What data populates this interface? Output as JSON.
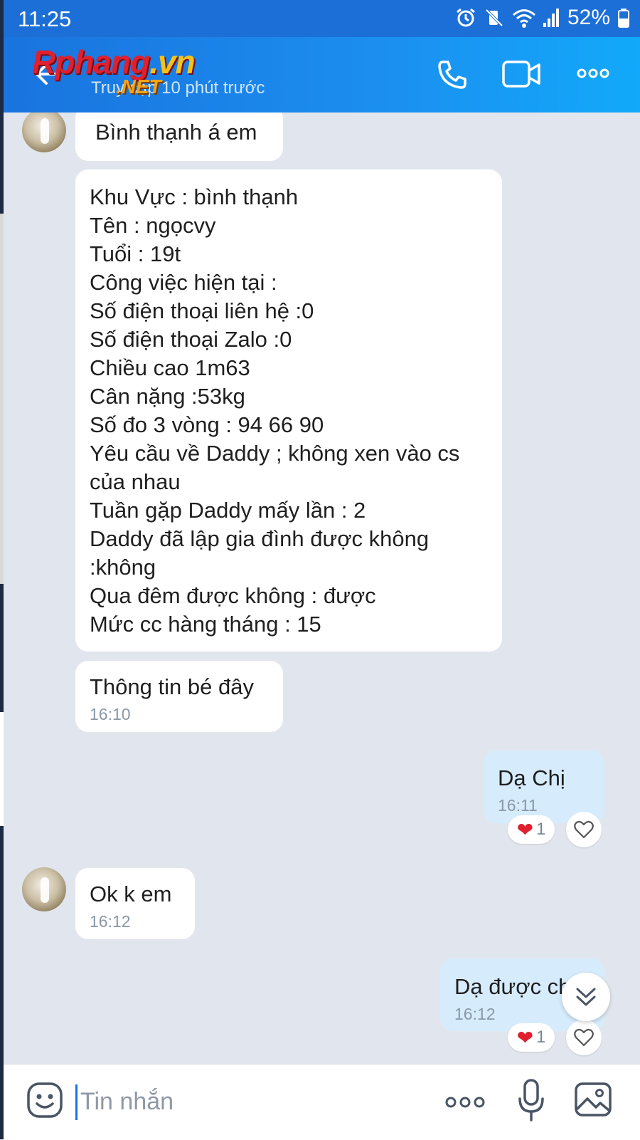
{
  "status_bar": {
    "time": "11:25",
    "battery": "52%"
  },
  "header": {
    "subtitle": "Truy cập 10 phút trước",
    "watermark": {
      "brand": "Rphang",
      "tld": "vn",
      "net": ".NET"
    }
  },
  "messages": [
    {
      "id": "m1",
      "direction": "in",
      "text": "Bình thạnh á em",
      "time": ""
    },
    {
      "id": "m2",
      "direction": "in",
      "text": "Khu Vực : bình thạnh\nTên : ngọcvy\nTuổi : 19t\nCông việc hiện tại :\nSố điện thoại liên hệ :0\nSố điện thoại Zalo :0\nChiều cao 1m63\nCân nặng :53kg\nSố đo 3 vòng : 94 66 90\nYêu cầu về Daddy ; không xen vào cs của nhau\nTuần gặp Daddy mấy lần : 2\nDaddy đã lập gia đình được không :không\nQua đêm được không : được\nMức cc hàng tháng : 15",
      "time": ""
    },
    {
      "id": "m3",
      "direction": "in",
      "text": "Thông tin bé đây",
      "time": "16:10"
    },
    {
      "id": "m4",
      "direction": "out",
      "text": "Dạ Chị",
      "time": "16:11",
      "reaction_count": "1"
    },
    {
      "id": "m5",
      "direction": "in",
      "text": "Ok k em",
      "time": "16:12"
    },
    {
      "id": "m6",
      "direction": "out",
      "text": "Dạ được chị",
      "time": "16:12",
      "reaction_count": "1"
    }
  ],
  "input": {
    "placeholder": "Tin nhắn"
  },
  "icons": {
    "back": "back-arrow-icon",
    "call": "phone-icon",
    "video": "video-camera-icon",
    "more": "more-dots-icon",
    "emoji": "emoji-icon",
    "mic": "microphone-icon",
    "image": "image-icon",
    "scroll": "double-chevron-down-icon"
  },
  "colors": {
    "header": "#1a73de",
    "outgoing_bubble": "#d6ecfd",
    "background": "#e1e6ee",
    "reaction_heart": "#e0202e"
  }
}
